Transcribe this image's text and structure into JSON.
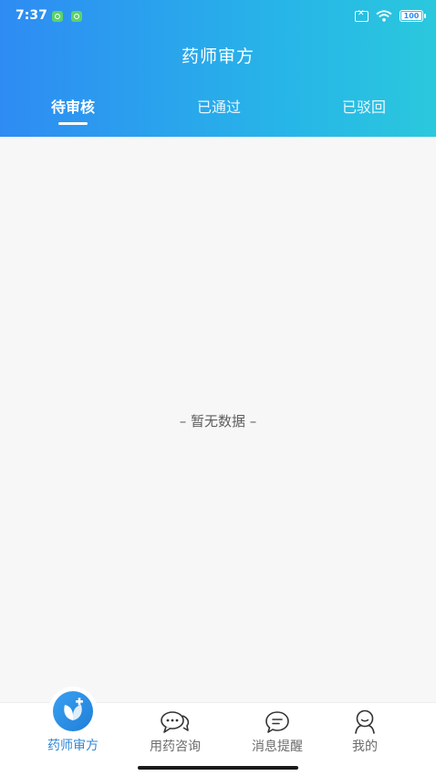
{
  "status_bar": {
    "time": "7:37",
    "battery_level": "100",
    "battery_fraction": 1.0
  },
  "header": {
    "title": "药师审方"
  },
  "tabs": [
    {
      "label": "待审核",
      "active": true
    },
    {
      "label": "已通过",
      "active": false
    },
    {
      "label": "已驳回",
      "active": false
    }
  ],
  "empty_state": {
    "text": "– 暂无数据 –"
  },
  "tabbar": {
    "items": [
      {
        "label": "药师审方",
        "icon": "pharmacist-review-icon",
        "active": true
      },
      {
        "label": "用药咨询",
        "icon": "chat-bubbles-icon",
        "active": false
      },
      {
        "label": "消息提醒",
        "icon": "message-icon",
        "active": false
      },
      {
        "label": "我的",
        "icon": "user-icon",
        "active": false
      }
    ]
  },
  "colors": {
    "header_start": "#2e8bf3",
    "header_end": "#2ac8dd",
    "accent": "#2f86d6",
    "background": "#f7f7f7"
  }
}
